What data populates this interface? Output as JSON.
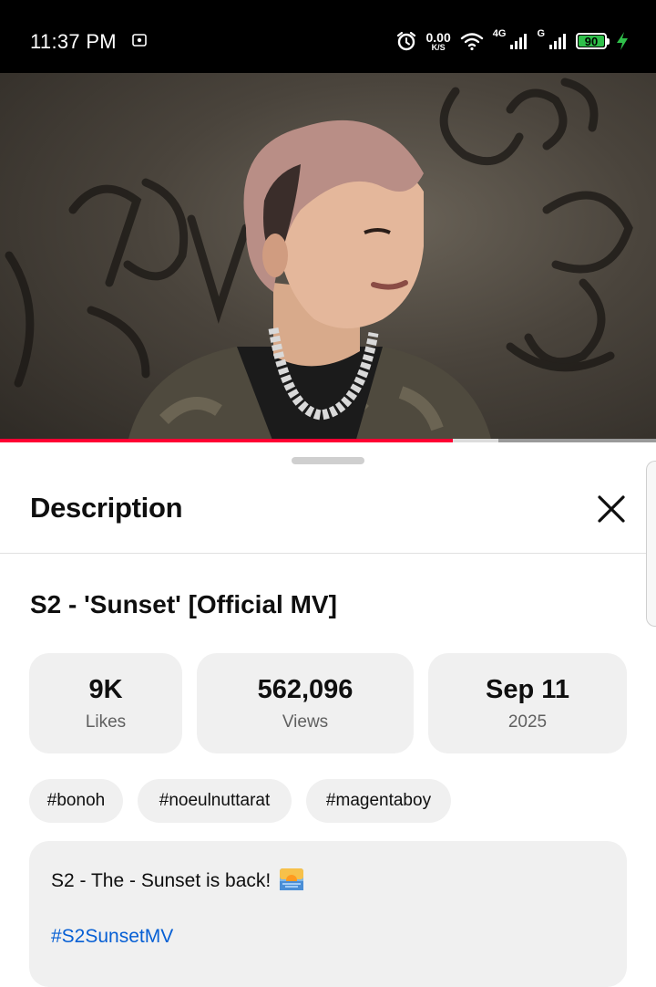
{
  "status_bar": {
    "time": "11:37 PM",
    "data_rate": "0.00",
    "data_rate_unit": "K/S",
    "network_1": "4G",
    "network_2": "G",
    "battery_level": "90",
    "icons": [
      "screenshot-icon",
      "alarm-icon",
      "wifi-icon",
      "signal-icon",
      "signal-icon",
      "battery-icon",
      "charging-icon"
    ]
  },
  "player": {
    "played_fraction": 0.69,
    "buffered_fraction": 0.76,
    "accent_color": "#ff0033"
  },
  "sheet": {
    "title": "Description",
    "close_icon": "close-icon"
  },
  "video": {
    "title": "S2 - 'Sunset' [Official MV]",
    "stats": [
      {
        "value": "9K",
        "label": "Likes"
      },
      {
        "value": "562,096",
        "label": "Views"
      },
      {
        "value": "Sep 11",
        "label": "2025"
      }
    ],
    "tags": [
      "#bonoh",
      "#noeulnuttarat",
      "#magentaboy"
    ],
    "description_line": "S2 - The - Sunset is back!",
    "description_hashtag": "#S2SunsetMV",
    "link_color": "#065fd4"
  }
}
